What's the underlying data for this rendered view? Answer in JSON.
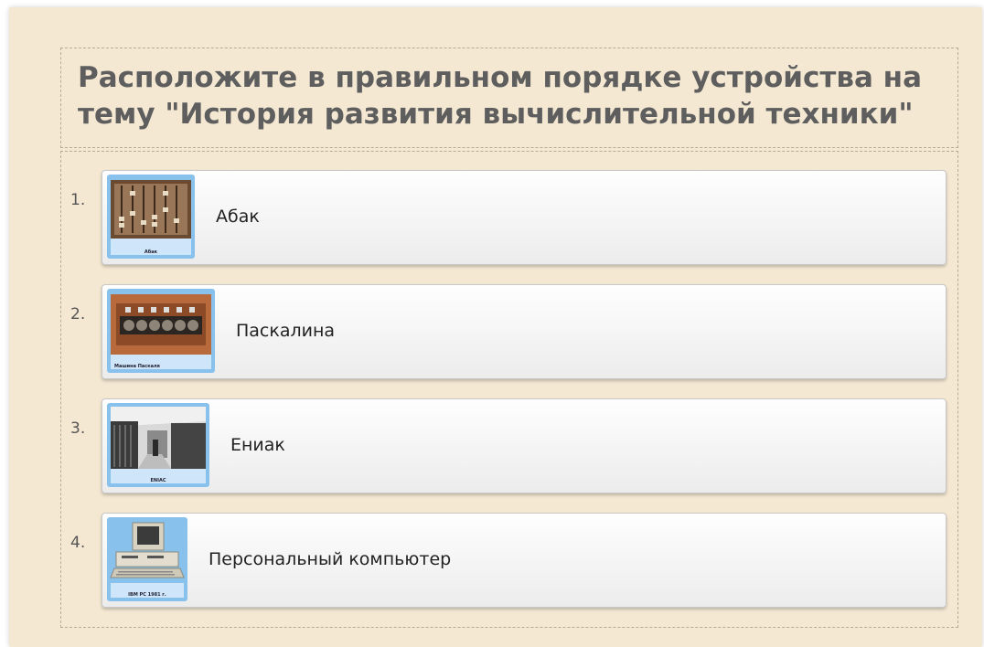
{
  "question": {
    "title": "Расположите в правильном порядке устройства на тему \"История развития вычислительной техники\""
  },
  "items": [
    {
      "number": "1.",
      "label": "Абак",
      "image_icon": "abacus-image",
      "image_caption": "Абак"
    },
    {
      "number": "2.",
      "label": "Паскалина",
      "image_icon": "pascaline-image",
      "image_caption": "Машина Паскаля"
    },
    {
      "number": "3.",
      "label": "Ениак",
      "image_icon": "eniac-image",
      "image_caption": "ENIAC"
    },
    {
      "number": "4.",
      "label": "Персональный компьютер",
      "image_icon": "ibm-pc-image",
      "image_caption": "IBM PC 1981 г."
    }
  ],
  "colors": {
    "background": "#f4e8d2",
    "thumb_frame": "#87c1ec",
    "title_text": "#5e5e5e"
  }
}
